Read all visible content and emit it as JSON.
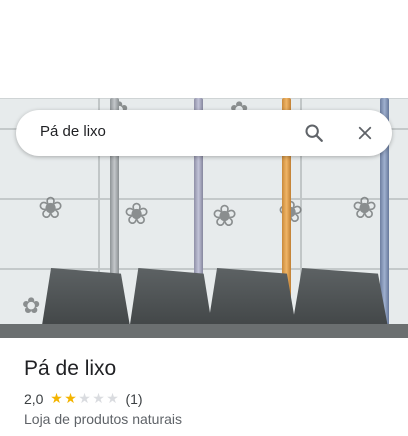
{
  "search": {
    "query": "Pá de lixo"
  },
  "place": {
    "title": "Pá de lixo",
    "rating": "2,0",
    "rating_value": 2,
    "rating_max": 5,
    "review_count": "(1)",
    "category": "Loja de produtos naturais"
  },
  "icons": {
    "search": "search-icon",
    "close": "close-icon",
    "star": "star-icon"
  },
  "colors": {
    "star_filled": "#f4b400",
    "star_empty": "#dadce0"
  }
}
